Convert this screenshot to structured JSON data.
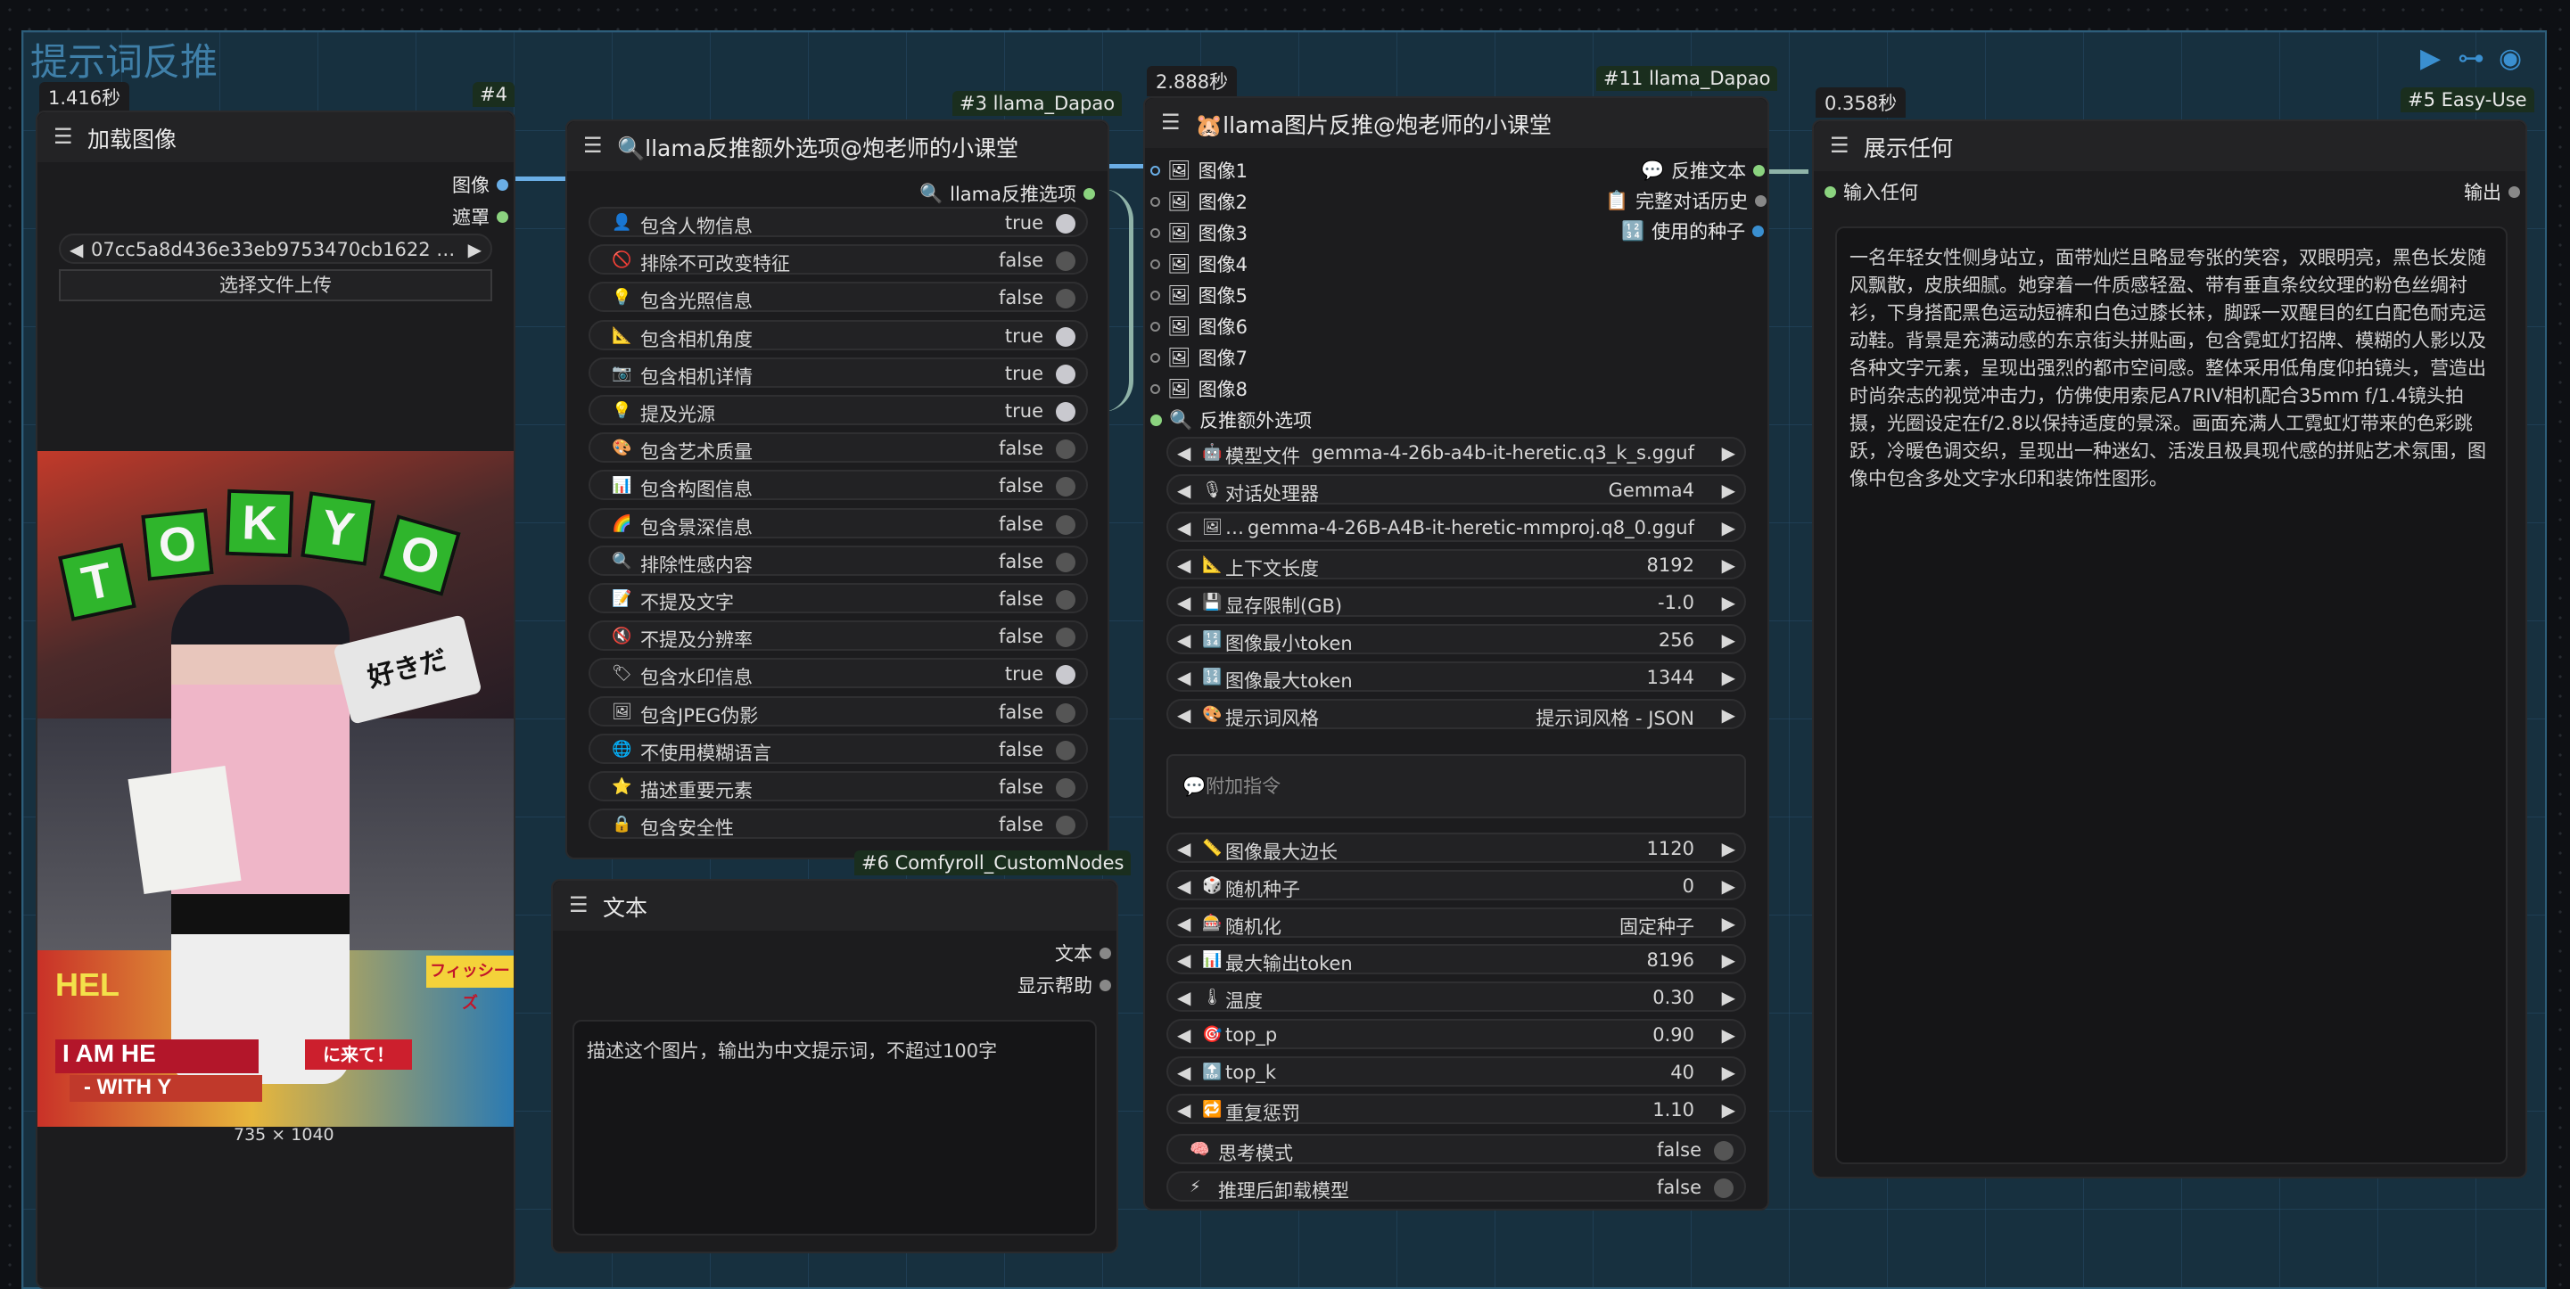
{
  "group": {
    "title": "提示词反推"
  },
  "load_image": {
    "badge": "#4",
    "time": "1.416秒",
    "title": "加载图像",
    "outputs": [
      "图像",
      "遮罩"
    ],
    "file": "07cc5a8d436e33eb9753470cb1622 …",
    "upload_label": "选择文件上传",
    "dims": "735 × 1040",
    "image_text": {
      "letters": [
        "T",
        "O",
        "K",
        "Y",
        "O"
      ],
      "stamp": "好きだ",
      "banner1": "I AM HE",
      "banner2": "- WITH Y",
      "sticker1": "フィッシーズ",
      "sticker2": "に来て！",
      "banner_top": "HEL"
    }
  },
  "extra_options": {
    "badge": "#3 llama_Dapao",
    "title": "llama反推额外选项@炮老师的小课堂",
    "output": "llama反推选项",
    "items": [
      {
        "emoji": "👤",
        "label": "包含人物信息",
        "value": "true",
        "on": true
      },
      {
        "emoji": "🚫",
        "label": "排除不可改变特征",
        "value": "false",
        "on": false
      },
      {
        "emoji": "💡",
        "label": "包含光照信息",
        "value": "false",
        "on": false
      },
      {
        "emoji": "📐",
        "label": "包含相机角度",
        "value": "true",
        "on": true
      },
      {
        "emoji": "📷",
        "label": "包含相机详情",
        "value": "true",
        "on": true
      },
      {
        "emoji": "💡",
        "label": "提及光源",
        "value": "true",
        "on": true
      },
      {
        "emoji": "🎨",
        "label": "包含艺术质量",
        "value": "false",
        "on": false
      },
      {
        "emoji": "📊",
        "label": "包含构图信息",
        "value": "false",
        "on": false
      },
      {
        "emoji": "🌈",
        "label": "包含景深信息",
        "value": "false",
        "on": false
      },
      {
        "emoji": "🔍",
        "label": "排除性感内容",
        "value": "false",
        "on": false
      },
      {
        "emoji": "📝",
        "label": "不提及文字",
        "value": "false",
        "on": false
      },
      {
        "emoji": "🔇",
        "label": "不提及分辨率",
        "value": "false",
        "on": false
      },
      {
        "emoji": "🏷",
        "label": "包含水印信息",
        "value": "true",
        "on": true
      },
      {
        "emoji": "🖼",
        "label": "包含JPEG伪影",
        "value": "false",
        "on": false
      },
      {
        "emoji": "🌐",
        "label": "不使用模糊语言",
        "value": "false",
        "on": false
      },
      {
        "emoji": "⭐",
        "label": "描述重要元素",
        "value": "false",
        "on": false
      },
      {
        "emoji": "🔒",
        "label": "包含安全性",
        "value": "false",
        "on": false
      }
    ]
  },
  "text_node": {
    "badge": "#6 Comfyroll_CustomNodes",
    "title": "文本",
    "outputs": [
      "文本",
      "显示帮助"
    ],
    "content": "描述这个图片，输出为中文提示词，不超过100字"
  },
  "main_node": {
    "badge": "#11 llama_Dapao",
    "time": "2.888秒",
    "title": "llama图片反推@炮老师的小课堂",
    "inputs": [
      "图像1",
      "图像2",
      "图像3",
      "图像4",
      "图像5",
      "图像6",
      "图像7",
      "图像8",
      "反推额外选项"
    ],
    "outputs": [
      "反推文本",
      "完整对话历史",
      "使用的种子"
    ],
    "widgets_top": [
      {
        "emoji": "🤖",
        "label": "模型文件",
        "value": "gemma-4-26b-a4b-it-heretic.q3_k_s.gguf"
      },
      {
        "emoji": "🎙",
        "label": "对话处理器",
        "value": "Gemma4"
      },
      {
        "emoji": "🖼",
        "label": "…",
        "value": "gemma-4-26B-A4B-it-heretic-mmproj.q8_0.gguf"
      },
      {
        "emoji": "📐",
        "label": "上下文长度",
        "value": "8192"
      },
      {
        "emoji": "💾",
        "label": "显存限制(GB)",
        "value": "-1.0"
      },
      {
        "emoji": "🔢",
        "label": "图像最小token",
        "value": "256"
      },
      {
        "emoji": "🔢",
        "label": "图像最大token",
        "value": "1344"
      },
      {
        "emoji": "🎨",
        "label": "提示词风格",
        "value": "提示词风格 - JSON"
      }
    ],
    "extra_placeholder": "💬附加指令",
    "widgets_bottom": [
      {
        "emoji": "📏",
        "label": "图像最大边长",
        "value": "1120"
      },
      {
        "emoji": "🎲",
        "label": "随机种子",
        "value": "0"
      },
      {
        "emoji": "🎰",
        "label": "随机化",
        "value": "固定种子"
      },
      {
        "emoji": "📊",
        "label": "最大输出token",
        "value": "8196"
      },
      {
        "emoji": "🌡",
        "label": "温度",
        "value": "0.30"
      },
      {
        "emoji": "🎯",
        "label": "top_p",
        "value": "0.90"
      },
      {
        "emoji": "🔝",
        "label": "top_k",
        "value": "40"
      },
      {
        "emoji": "🔁",
        "label": "重复惩罚",
        "value": "1.10"
      }
    ],
    "toggles": [
      {
        "emoji": "🧠",
        "label": "思考模式",
        "value": "false"
      },
      {
        "emoji": "⚡",
        "label": "推理后卸载模型",
        "value": "false"
      }
    ]
  },
  "show_any": {
    "badge": "#5 Easy-Use",
    "time": "0.358秒",
    "title": "展示任何",
    "input": "输入任何",
    "output": "输出",
    "content": "一名年轻女性侧身站立，面带灿烂且略显夸张的笑容，双眼明亮，黑色长发随风飘散，皮肤细腻。她穿着一件质感轻盈、带有垂直条纹纹理的粉色丝绸衬衫，下身搭配黑色运动短裤和白色过膝长袜，脚踩一双醒目的红白配色耐克运动鞋。背景是充满动感的东京街头拼贴画，包含霓虹灯招牌、模糊的人影以及各种文字元素，呈现出强烈的都市空间感。整体采用低角度仰拍镜头，营造出时尚杂志的视觉冲击力，仿佛使用索尼A7RIV相机配合35mm f/1.4镜头拍摄，光圈设定在f/2.8以保持适度的景深。画面充满人工霓虹灯带来的色彩跳跃，冷暖色调交织，呈现出一种迷幻、活泼且极具现代感的拼贴艺术氛围，图像中包含多处文字水印和装饰性图形。"
  },
  "colors": {
    "accent": "#6aaee6",
    "group_bg": "#17303f",
    "node_bg": "#1c1c1e"
  }
}
